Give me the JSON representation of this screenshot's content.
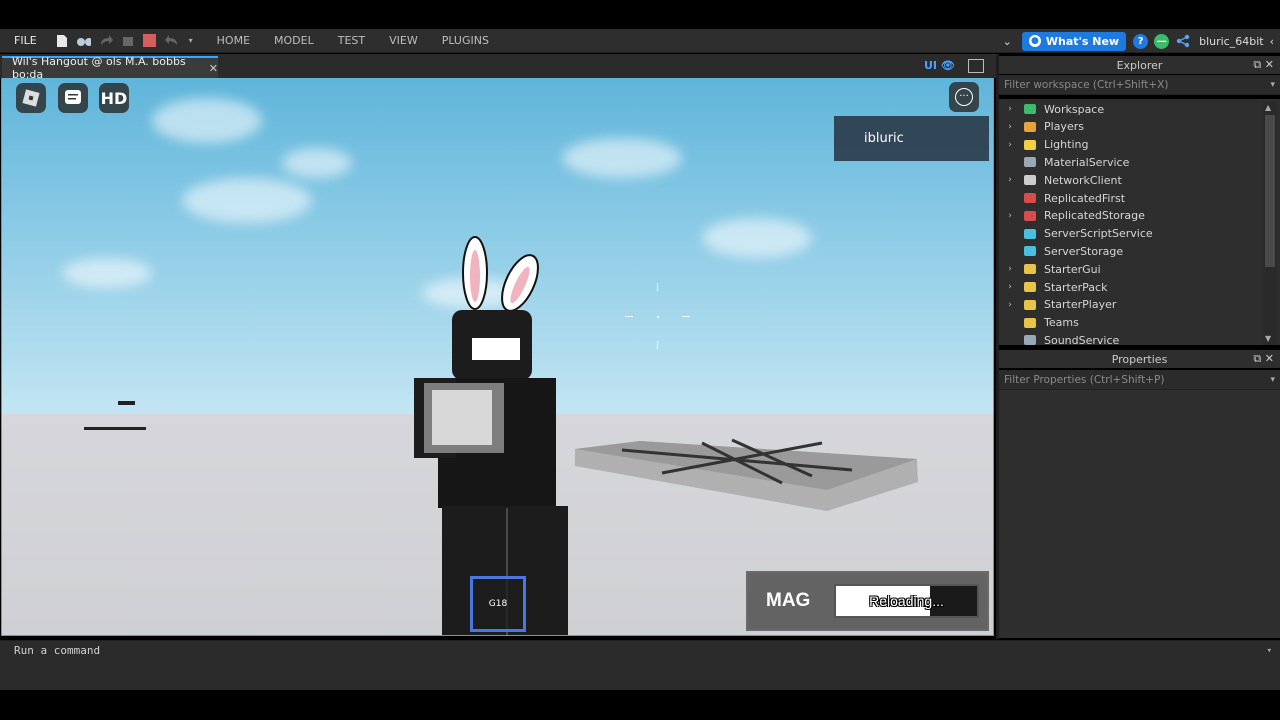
{
  "ribbon": {
    "file_label": "FILE",
    "tabs": [
      "HOME",
      "MODEL",
      "TEST",
      "VIEW",
      "PLUGINS"
    ],
    "whats_new_label": "What's New",
    "username": "bluric_64bit"
  },
  "document": {
    "tab_title": "Wil's Hangout @ ols M.A. bobbs bo:da",
    "ui_toggle_label": "UI"
  },
  "viewport": {
    "hud_buttons": [
      {
        "name": "roblox-menu",
        "icon": "roblox-logo-icon",
        "label": ""
      },
      {
        "name": "chat",
        "icon": "chat-icon",
        "label": ""
      },
      {
        "name": "hd",
        "icon": "hd-icon",
        "label": "HD"
      }
    ],
    "player_name": "ibluric",
    "hotbar_slot_label": "G18",
    "ammo": {
      "title": "MAG",
      "status": "Reloading...",
      "fill_fraction": 0.67
    }
  },
  "explorer": {
    "title": "Explorer",
    "filter_placeholder": "Filter workspace (Ctrl+Shift+X)",
    "items": [
      {
        "label": "Workspace",
        "expandable": true,
        "icon": "workspace-icon",
        "color": "#3dbb6b"
      },
      {
        "label": "Players",
        "expandable": true,
        "icon": "players-icon",
        "color": "#e6a23c"
      },
      {
        "label": "Lighting",
        "expandable": true,
        "icon": "lighting-icon",
        "color": "#f2d045"
      },
      {
        "label": "MaterialService",
        "expandable": false,
        "icon": "material-service-icon",
        "color": "#9aa7b5"
      },
      {
        "label": "NetworkClient",
        "expandable": true,
        "icon": "network-client-icon",
        "color": "#cccccc"
      },
      {
        "label": "ReplicatedFirst",
        "expandable": false,
        "icon": "replicated-first-icon",
        "color": "#d94c4c"
      },
      {
        "label": "ReplicatedStorage",
        "expandable": true,
        "icon": "replicated-storage-icon",
        "color": "#d94c4c"
      },
      {
        "label": "ServerScriptService",
        "expandable": false,
        "icon": "server-script-service-icon",
        "color": "#4ac0e0"
      },
      {
        "label": "ServerStorage",
        "expandable": false,
        "icon": "server-storage-icon",
        "color": "#4ac0e0"
      },
      {
        "label": "StarterGui",
        "expandable": true,
        "icon": "starter-gui-icon",
        "color": "#e8c54a"
      },
      {
        "label": "StarterPack",
        "expandable": true,
        "icon": "starter-pack-icon",
        "color": "#e8c54a"
      },
      {
        "label": "StarterPlayer",
        "expandable": true,
        "icon": "starter-player-icon",
        "color": "#e8c54a"
      },
      {
        "label": "Teams",
        "expandable": false,
        "icon": "teams-icon",
        "color": "#e8c54a"
      },
      {
        "label": "SoundService",
        "expandable": false,
        "icon": "sound-service-icon",
        "color": "#9aa7b5"
      }
    ]
  },
  "properties": {
    "title": "Properties",
    "filter_placeholder": "Filter Properties (Ctrl+Shift+P)"
  },
  "command_bar": {
    "placeholder": "Run a command"
  }
}
